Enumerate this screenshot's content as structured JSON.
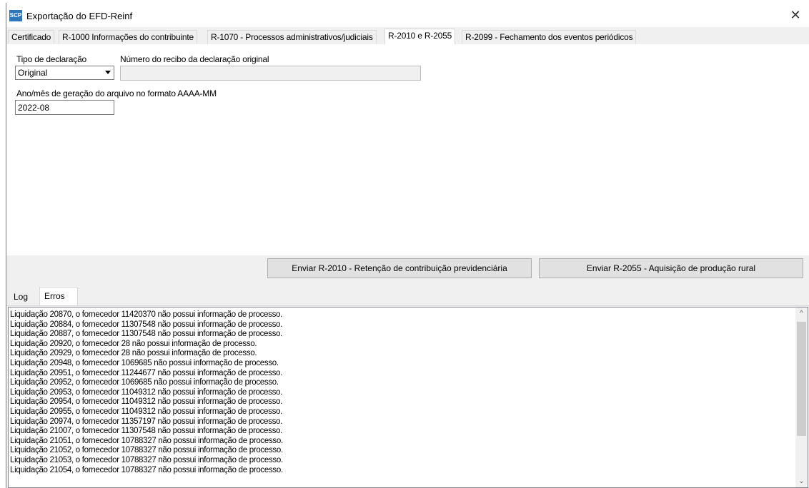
{
  "window": {
    "title": "Exportação do EFD-Reinf",
    "app_icon_text": "SCP"
  },
  "tabs": [
    {
      "label": "Certificado"
    },
    {
      "label": "R-1000 Informações do contribuinte"
    },
    {
      "label": "R-1070 - Processos administrativos/judiciais"
    },
    {
      "label": "R-2010 e R-2055"
    },
    {
      "label": "R-2099 - Fechamento dos eventos periódicos"
    }
  ],
  "form": {
    "tipo_label": "Tipo de declaração",
    "tipo_value": "Original",
    "recibo_label": "Número do recibo da declaração original",
    "recibo_value": "",
    "ano_mes_label": "Ano/mês de geração do arquivo no formato AAAA-MM",
    "ano_mes_value": "2022-08"
  },
  "buttons": {
    "r2010": "Enviar R-2010 - Retenção de contribuição previdenciária",
    "r2055": "Enviar R-2055 - Aquisição de produção rural"
  },
  "lower_tabs": [
    {
      "label": "Log"
    },
    {
      "label": "Erros"
    }
  ],
  "errors": [
    "Liquidação 20870, o fornecedor 11420370 não possui informação de processo.",
    "Liquidação 20884, o fornecedor 11307548 não possui informação de processo.",
    "Liquidação 20887, o fornecedor 11307548 não possui informação de processo.",
    "Liquidação 20920, o fornecedor 28 não possui informação de processo.",
    "Liquidação 20929, o fornecedor 28 não possui informação de processo.",
    "Liquidação 20948, o fornecedor 1069685 não possui informação de processo.",
    "Liquidação 20951, o fornecedor 11244677 não possui informação de processo.",
    "Liquidação 20952, o fornecedor 1069685 não possui informação de processo.",
    "Liquidação 20953, o fornecedor 11049312 não possui informação de processo.",
    "Liquidação 20954, o fornecedor 11049312 não possui informação de processo.",
    "Liquidação 20955, o fornecedor 11049312 não possui informação de processo.",
    "Liquidação 20974, o fornecedor 11357197 não possui informação de processo.",
    "Liquidação 21007, o fornecedor 11307548 não possui informação de processo.",
    "Liquidação 21051, o fornecedor 10788327 não possui informação de processo.",
    "Liquidação 21052, o fornecedor 10788327 não possui informação de processo.",
    "Liquidação 21053, o fornecedor 10788327 não possui informação de processo.",
    "Liquidação 21054, o fornecedor 10788327 não possui informação de processo."
  ],
  "icons": {
    "close": "close-icon",
    "scroll_up": "chevron-up-icon",
    "scroll_down": "chevron-down-icon",
    "dropdown": "caret-down-icon"
  }
}
